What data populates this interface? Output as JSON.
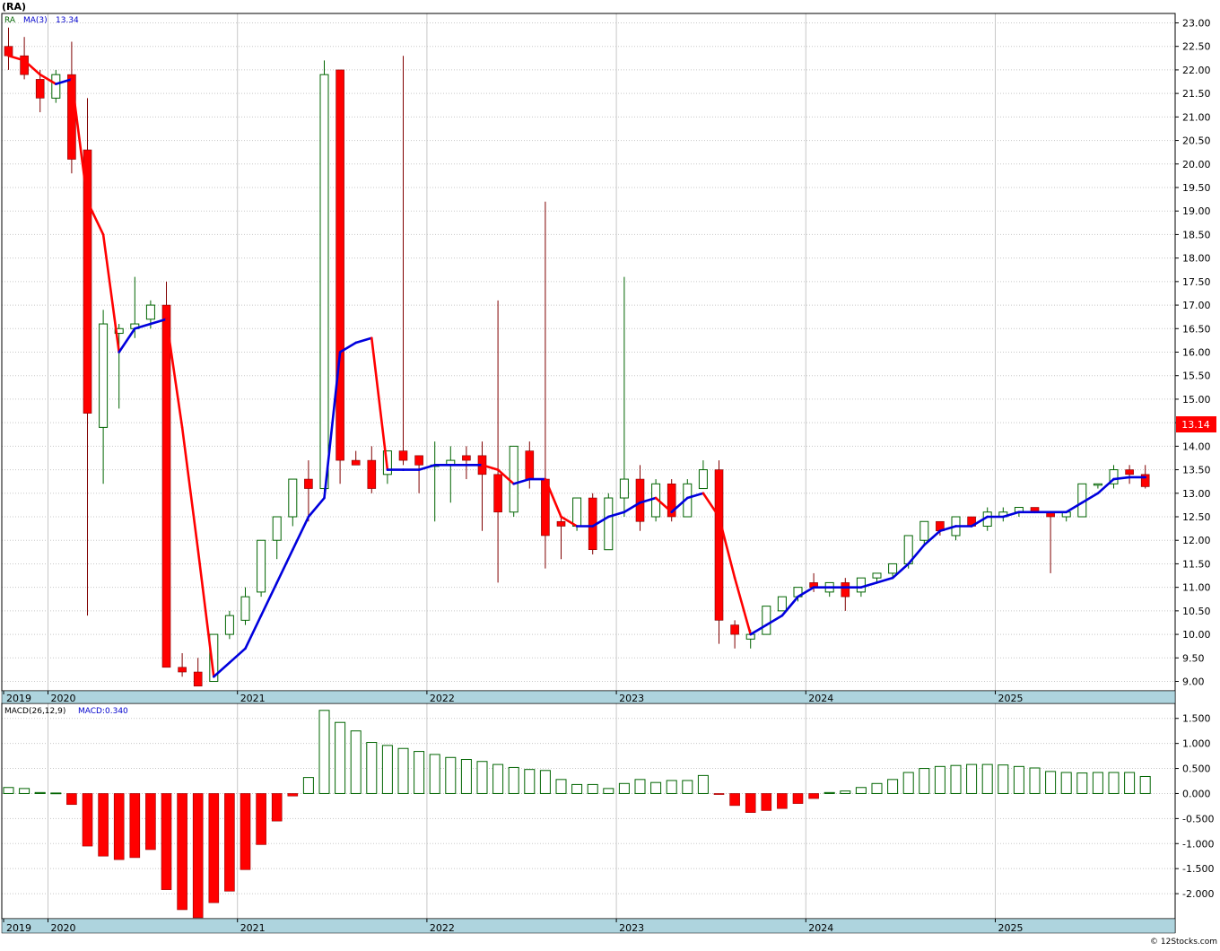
{
  "ticker_label": "(RA)",
  "price_legend": {
    "symbol": "RA",
    "ma_label": "MA(3)",
    "ma_value": "13.34",
    "last_price": "13.14"
  },
  "macd_legend": {
    "label": "MACD(26,12,9)",
    "value_label": "MACD:0.340"
  },
  "watermark": "© 12Stocks.com",
  "colors": {
    "up": "#006400",
    "down": "#ff0000",
    "ma_up": "#0000dd",
    "ma_down": "#ff0000",
    "date_band": "#aed4de",
    "grid": "#c8c8c8"
  },
  "chart_data": {
    "type": "candlestick",
    "timeframe": "monthly",
    "start_month": "2019-10",
    "time_labels": [
      "2019",
      "2020",
      "2021",
      "2022",
      "2023",
      "2024",
      "2025"
    ],
    "price_ylim": [
      8.8,
      23.2
    ],
    "price_ticks": [
      "9.00",
      "9.50",
      "10.00",
      "10.50",
      "11.00",
      "11.50",
      "12.00",
      "12.50",
      "13.00",
      "13.50",
      "14.00",
      "14.50",
      "15.00",
      "15.50",
      "16.00",
      "16.50",
      "17.00",
      "17.50",
      "18.00",
      "18.50",
      "19.00",
      "19.50",
      "20.00",
      "20.50",
      "21.00",
      "21.50",
      "22.00",
      "22.50",
      "23.00"
    ],
    "ohlc": [
      [
        22.5,
        22.9,
        22.0,
        22.3
      ],
      [
        22.3,
        22.7,
        21.8,
        21.9
      ],
      [
        21.8,
        22.0,
        21.1,
        21.4
      ],
      [
        21.4,
        22.0,
        21.3,
        21.9
      ],
      [
        21.9,
        22.6,
        19.8,
        20.1
      ],
      [
        20.3,
        21.4,
        10.4,
        14.7
      ],
      [
        14.4,
        16.9,
        13.2,
        16.6
      ],
      [
        16.4,
        16.6,
        14.8,
        16.5
      ],
      [
        16.5,
        17.6,
        16.3,
        16.6
      ],
      [
        16.7,
        17.1,
        16.5,
        17.0
      ],
      [
        17.0,
        17.5,
        9.3,
        9.3
      ],
      [
        9.3,
        9.6,
        9.1,
        9.2
      ],
      [
        9.2,
        9.5,
        8.9,
        8.9
      ],
      [
        9.0,
        10.0,
        9.0,
        10.0
      ],
      [
        10.0,
        10.5,
        9.9,
        10.4
      ],
      [
        10.3,
        11.0,
        10.2,
        10.8
      ],
      [
        10.9,
        11.4,
        10.8,
        12.0
      ],
      [
        12.0,
        12.3,
        11.6,
        12.5
      ],
      [
        12.5,
        13.3,
        12.3,
        13.3
      ],
      [
        13.3,
        13.7,
        12.4,
        13.1
      ],
      [
        13.1,
        22.2,
        13.0,
        21.9
      ],
      [
        22.0,
        22.0,
        13.2,
        13.7
      ],
      [
        13.7,
        13.9,
        13.6,
        13.6
      ],
      [
        13.7,
        14.0,
        13.0,
        13.1
      ],
      [
        13.4,
        13.8,
        13.2,
        13.9
      ],
      [
        13.9,
        22.3,
        13.6,
        13.7
      ],
      [
        13.8,
        13.8,
        13.0,
        13.6
      ],
      [
        13.6,
        14.1,
        12.4,
        13.6
      ],
      [
        13.6,
        14.0,
        12.8,
        13.7
      ],
      [
        13.8,
        14.0,
        13.3,
        13.7
      ],
      [
        13.8,
        14.1,
        12.2,
        13.4
      ],
      [
        13.4,
        17.1,
        11.1,
        12.6
      ],
      [
        12.6,
        14.0,
        12.5,
        14.0
      ],
      [
        13.9,
        14.1,
        13.1,
        13.3
      ],
      [
        13.3,
        19.2,
        11.4,
        12.1
      ],
      [
        12.4,
        12.5,
        11.6,
        12.3
      ],
      [
        12.3,
        12.9,
        12.2,
        12.9
      ],
      [
        12.9,
        13.0,
        11.7,
        11.8
      ],
      [
        11.8,
        13.0,
        11.8,
        12.9
      ],
      [
        12.9,
        17.6,
        12.5,
        13.3
      ],
      [
        13.3,
        13.6,
        12.2,
        12.4
      ],
      [
        12.5,
        13.3,
        12.4,
        13.2
      ],
      [
        13.2,
        13.3,
        12.4,
        12.5
      ],
      [
        12.5,
        13.3,
        12.5,
        13.2
      ],
      [
        13.1,
        13.7,
        13.1,
        13.5
      ],
      [
        13.5,
        13.7,
        9.8,
        10.3
      ],
      [
        10.2,
        10.3,
        9.7,
        10.0
      ],
      [
        9.9,
        10.1,
        9.7,
        10.0
      ],
      [
        10.0,
        10.6,
        10.0,
        10.6
      ],
      [
        10.5,
        10.8,
        10.5,
        10.8
      ],
      [
        10.8,
        11.0,
        10.7,
        11.0
      ],
      [
        11.1,
        11.3,
        10.9,
        11.0
      ],
      [
        10.9,
        11.1,
        10.8,
        11.1
      ],
      [
        11.1,
        11.2,
        10.5,
        10.8
      ],
      [
        10.9,
        11.2,
        10.8,
        11.2
      ],
      [
        11.2,
        11.3,
        11.1,
        11.3
      ],
      [
        11.3,
        11.5,
        11.2,
        11.5
      ],
      [
        11.5,
        12.1,
        11.4,
        12.1
      ],
      [
        12.0,
        12.4,
        11.9,
        12.4
      ],
      [
        12.4,
        12.4,
        12.1,
        12.2
      ],
      [
        12.1,
        12.5,
        12.0,
        12.5
      ],
      [
        12.5,
        12.5,
        12.3,
        12.3
      ],
      [
        12.3,
        12.7,
        12.2,
        12.6
      ],
      [
        12.5,
        12.7,
        12.4,
        12.6
      ],
      [
        12.6,
        12.7,
        12.5,
        12.7
      ],
      [
        12.7,
        12.7,
        12.6,
        12.6
      ],
      [
        12.6,
        12.6,
        11.3,
        12.5
      ],
      [
        12.5,
        12.6,
        12.4,
        12.6
      ],
      [
        12.5,
        13.2,
        12.5,
        13.2
      ],
      [
        13.2,
        13.2,
        13.1,
        13.2
      ],
      [
        13.2,
        13.6,
        13.1,
        13.5
      ],
      [
        13.5,
        13.6,
        13.2,
        13.4
      ],
      [
        13.4,
        13.6,
        13.1,
        13.14
      ]
    ],
    "ma3": [
      22.3,
      22.2,
      21.9,
      21.7,
      21.8,
      19.2,
      18.5,
      16.0,
      16.5,
      16.6,
      16.7,
      14.4,
      11.8,
      9.1,
      9.4,
      9.7,
      10.4,
      11.1,
      11.8,
      12.5,
      12.9,
      16.0,
      16.2,
      16.3,
      13.5,
      13.5,
      13.5,
      13.6,
      13.6,
      13.6,
      13.6,
      13.5,
      13.2,
      13.3,
      13.3,
      12.5,
      12.3,
      12.3,
      12.5,
      12.6,
      12.8,
      12.9,
      12.6,
      12.9,
      13.0,
      12.5,
      11.2,
      10.0,
      10.2,
      10.4,
      10.8,
      11.0,
      11.0,
      11.0,
      11.0,
      11.1,
      11.2,
      11.5,
      11.9,
      12.2,
      12.3,
      12.3,
      12.5,
      12.5,
      12.6,
      12.6,
      12.6,
      12.6,
      12.8,
      13.0,
      13.3,
      13.34,
      13.34
    ],
    "macd_ylim": [
      -2.5,
      1.8
    ],
    "macd_ticks": [
      "-2.000",
      "-1.500",
      "-1.000",
      "-0.500",
      "0.000",
      "0.500",
      "1.000",
      "1.500"
    ],
    "macd": [
      0.12,
      0.1,
      0.02,
      0.01,
      -0.22,
      -1.05,
      -1.25,
      -1.32,
      -1.28,
      -1.12,
      -1.92,
      -2.32,
      -2.48,
      -2.18,
      -1.95,
      -1.52,
      -1.02,
      -0.55,
      -0.05,
      0.32,
      1.66,
      1.42,
      1.25,
      1.02,
      0.96,
      0.9,
      0.84,
      0.78,
      0.72,
      0.68,
      0.64,
      0.58,
      0.52,
      0.48,
      0.46,
      0.28,
      0.18,
      0.18,
      0.1,
      0.2,
      0.28,
      0.22,
      0.26,
      0.26,
      0.36,
      -0.02,
      -0.24,
      -0.38,
      -0.34,
      -0.3,
      -0.2,
      -0.1,
      0.02,
      0.05,
      0.12,
      0.2,
      0.28,
      0.42,
      0.5,
      0.54,
      0.56,
      0.58,
      0.58,
      0.57,
      0.54,
      0.51,
      0.44,
      0.42,
      0.41,
      0.42,
      0.42,
      0.42,
      0.34
    ]
  }
}
